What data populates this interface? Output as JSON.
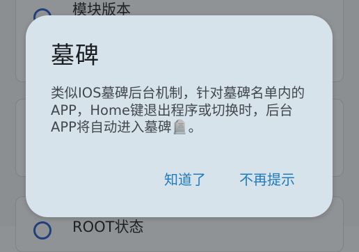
{
  "background": {
    "top_card_title": "模块版本",
    "bottom_card_title": "ROOT状态"
  },
  "dialog": {
    "title": "墓碑",
    "message": "类似IOS墓碑后台机制，针对墓碑名单内的APP，Home键退出程序或切换时，后台APP将自动进入墓碑🪦。",
    "buttons": {
      "ok": "知道了",
      "never": "不再提示"
    }
  },
  "colors": {
    "dialog_bg": "#d7e3ea",
    "accent": "#1f7ac2",
    "scrim": "#8c8f91"
  }
}
